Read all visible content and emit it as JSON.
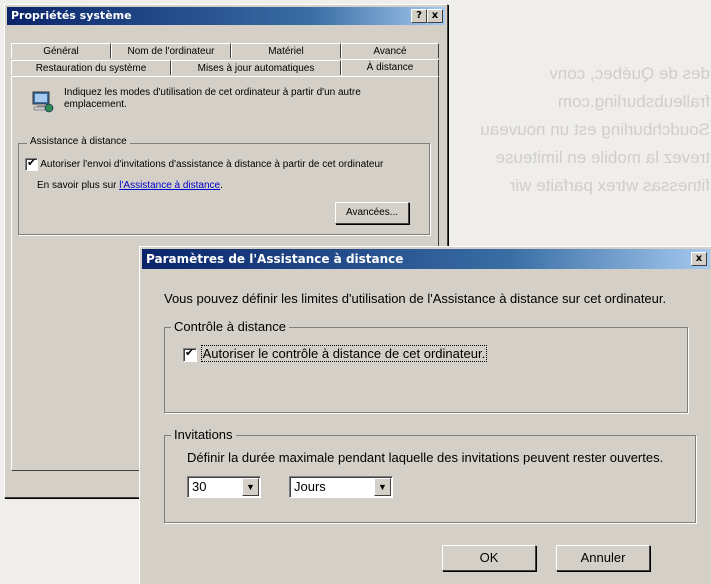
{
  "background_page": {
    "lines": [
      "des de Québec, conv",
      "fralleubsburling.com",
      "Soudchburling est un nouveau",
      "trevez la mobile en limiteuse",
      "fitnessas wtrex parfaite wir"
    ]
  },
  "system_properties": {
    "title": "Propriétés système",
    "help_button": "?",
    "close_button": "x",
    "tabs_row1": [
      "Général",
      "Nom de l'ordinateur",
      "Matériel",
      "Avancé"
    ],
    "tabs_row2": [
      "Restauration du système",
      "Mises à jour automatiques",
      "À distance"
    ],
    "intro_text": "Indiquez les modes d'utilisation de cet ordinateur à partir d'un autre emplacement.",
    "group_label": "Assistance à distance",
    "checkbox_label": "Autoriser l'envoi d'invitations d'assistance à distance à partir de cet ordinateur",
    "learn_more_prefix": "En savoir plus sur",
    "learn_more_link": "l'Assistance à distance",
    "learn_more_suffix": ".",
    "advanced_button": "Avancées..."
  },
  "remote_assistance_settings": {
    "title": "Paramètres de l'Assistance à distance",
    "close_button": "x",
    "description": "Vous pouvez définir les limites d'utilisation de l'Assistance à distance sur cet ordinateur.",
    "remote_control_group": "Contrôle à distance",
    "remote_control_checkbox": "Autoriser le contrôle à distance de cet ordinateur.",
    "invitations_group": "Invitations",
    "invitations_text": "Définir la durée maximale pendant laquelle des invitations peuvent rester ouvertes.",
    "duration_value": "30",
    "duration_unit": "Jours",
    "ok_button": "OK",
    "cancel_button": "Annuler"
  },
  "colors": {
    "dialog_face": "#d4d0c8",
    "titlebar_start": "#0a246a",
    "titlebar_end": "#a6caf0",
    "link": "#0000cc"
  }
}
